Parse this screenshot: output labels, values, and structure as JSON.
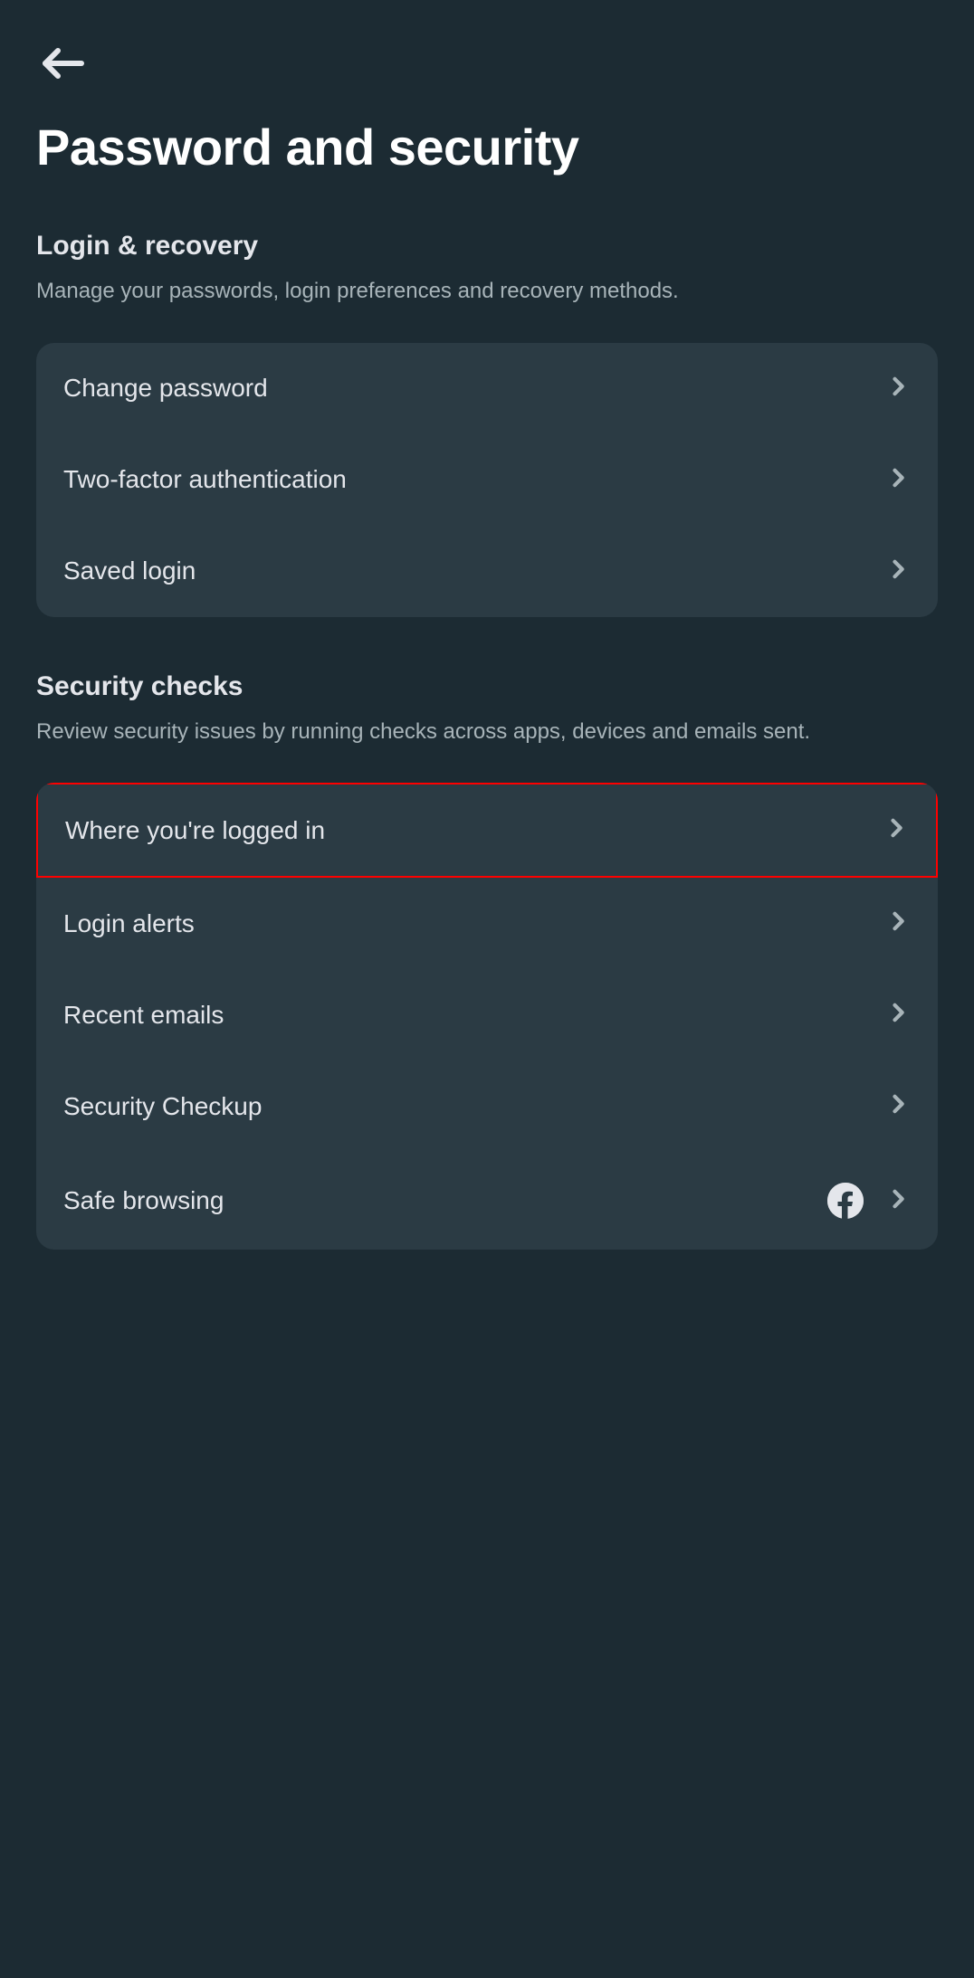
{
  "page": {
    "title": "Password and security"
  },
  "sections": {
    "login_recovery": {
      "title": "Login & recovery",
      "desc": "Manage your passwords, login preferences and recovery methods.",
      "items": [
        {
          "label": "Change password"
        },
        {
          "label": "Two-factor authentication"
        },
        {
          "label": "Saved login"
        }
      ]
    },
    "security_checks": {
      "title": "Security checks",
      "desc": "Review security issues by running checks across apps, devices and emails sent.",
      "items": [
        {
          "label": "Where you're logged in"
        },
        {
          "label": "Login alerts"
        },
        {
          "label": "Recent emails"
        },
        {
          "label": "Security Checkup"
        },
        {
          "label": "Safe browsing"
        }
      ]
    }
  }
}
